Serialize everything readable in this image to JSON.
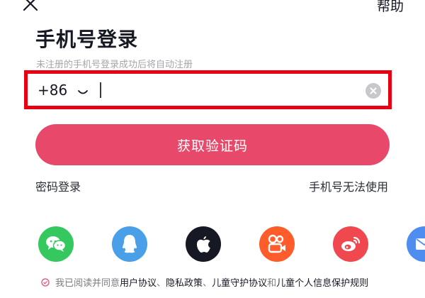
{
  "header": {
    "help_label": "帮助",
    "close_icon": "close-icon"
  },
  "title": "手机号登录",
  "subtitle": "未注册的手机号登录成功后将自动注册",
  "phone": {
    "country_code": "+86",
    "value": "",
    "chevron_icon": "chevron-down-icon",
    "clear_icon": "clear-icon",
    "highlight_color": "#e60012"
  },
  "get_code_button": {
    "label": "获取验证码",
    "color": "#e8496a"
  },
  "links": {
    "password_login": "密码登录",
    "phone_unavailable": "手机号无法使用"
  },
  "social_logins": [
    {
      "name": "wechat",
      "icon": "wechat-icon",
      "color": "#35c85e"
    },
    {
      "name": "qq",
      "icon": "qq-icon",
      "color": "#4aa0e8"
    },
    {
      "name": "apple",
      "icon": "apple-icon",
      "color": "#161823"
    },
    {
      "name": "kuaishou",
      "icon": "kuaishou-icon",
      "color": "#fe5c2b"
    },
    {
      "name": "weibo",
      "icon": "weibo-icon",
      "color": "#f0484f"
    },
    {
      "name": "email",
      "icon": "email-icon",
      "color": "#4f8ef0"
    }
  ],
  "agreement": {
    "prefix": "我已阅读并同意",
    "user_agreement": "用户协议",
    "sep1": "、",
    "privacy_policy": "隐私政策",
    "sep2": "、",
    "child_protection": "儿童守护协议",
    "and": "和",
    "child_info": "儿童个人信息保护规则",
    "check_icon": "unchecked-circle-icon"
  }
}
